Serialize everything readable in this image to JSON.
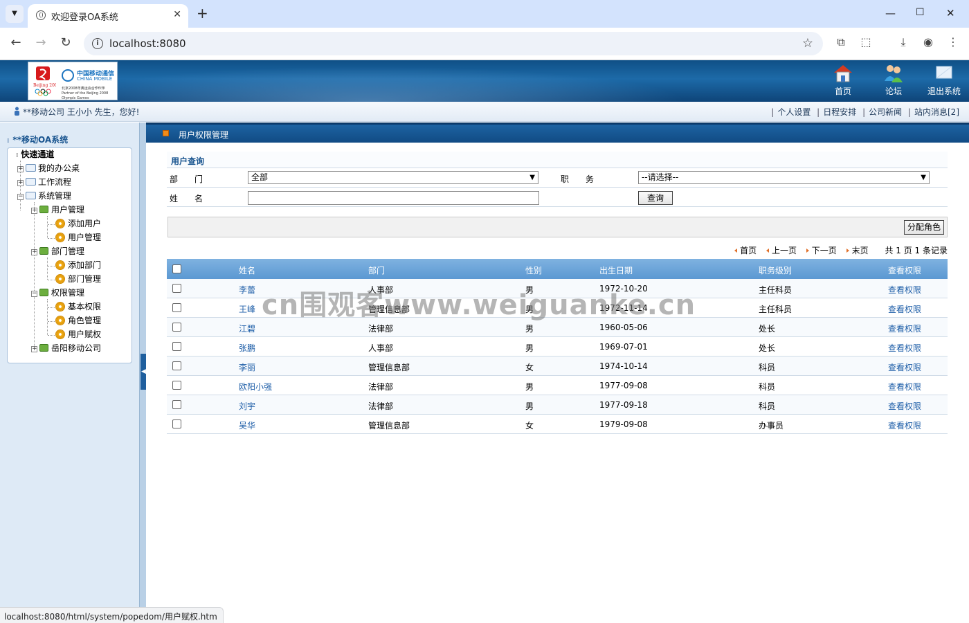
{
  "browser": {
    "tab_title": "欢迎登录OA系统",
    "url": "localhost:8080",
    "status_url": "localhost:8080/html/system/popedom/用户赋权.htm"
  },
  "header": {
    "logo": {
      "cm_cn": "中国移动通信",
      "cm_en": "CHINA MOBILE",
      "partner_text": "北京2008年奥运会合作伙伴 Partner of the Beijing 2008 Olympic Games"
    },
    "buttons": [
      {
        "label": "首页",
        "icon": "home-icon"
      },
      {
        "label": "论坛",
        "icon": "people-icon"
      },
      {
        "label": "退出系统",
        "icon": "exit-icon"
      }
    ]
  },
  "userbar": {
    "greeting": "**移动公司 王小小 先生，您好!",
    "links": [
      "个人设置",
      "日程安排",
      "公司新闻",
      "站内消息[2]"
    ]
  },
  "sidebar": {
    "title": "**移动OA系统",
    "tree": {
      "quick": "快速通道",
      "my_desk": "我的办公桌",
      "workflow": "工作流程",
      "system": "系统管理",
      "user_mgmt": "用户管理",
      "add_user": "添加用户",
      "user_mgmt_sub": "用户管理",
      "dept_mgmt": "部门管理",
      "add_dept": "添加部门",
      "dept_mgmt_sub": "部门管理",
      "perm_mgmt": "权限管理",
      "basic_perm": "基本权限",
      "role_mgmt": "角色管理",
      "user_grant": "用户赋权",
      "yueyang": "岳阳移动公司"
    }
  },
  "main": {
    "section_title": "用户权限管理",
    "query": {
      "title": "用户查询",
      "dept_label": "部　　门",
      "dept_value": "全部",
      "position_label": "职　　务",
      "position_value": "--请选择--",
      "name_label": "姓　　名",
      "search_button": "查询"
    },
    "assign_role_button": "分配角色",
    "pager": {
      "first": "首页",
      "prev": "上一页",
      "next": "下一页",
      "last": "末页",
      "summary": "共 1 页 1 条记录"
    },
    "columns": [
      "姓名",
      "部门",
      "性别",
      "出生日期",
      "职务级别",
      "查看权限"
    ],
    "rows": [
      [
        "李蕾",
        "人事部",
        "男",
        "1972-10-20",
        "主任科员",
        "查看权限"
      ],
      [
        "王峰",
        "管理信息部",
        "男",
        "1972-11-14",
        "主任科员",
        "查看权限"
      ],
      [
        "江碧",
        "法律部",
        "男",
        "1960-05-06",
        "处长",
        "查看权限"
      ],
      [
        "张鹏",
        "人事部",
        "男",
        "1969-07-01",
        "处长",
        "查看权限"
      ],
      [
        "李丽",
        "管理信息部",
        "女",
        "1974-10-14",
        "科员",
        "查看权限"
      ],
      [
        "欧阳小强",
        "法律部",
        "男",
        "1977-09-08",
        "科员",
        "查看权限"
      ],
      [
        "刘宇",
        "法律部",
        "男",
        "1977-09-18",
        "科员",
        "查看权限"
      ],
      [
        "吴华",
        "管理信息部",
        "女",
        "1979-09-08",
        "办事员",
        "查看权限"
      ]
    ]
  },
  "watermark": "cn围观客www.weiguanke.cn"
}
